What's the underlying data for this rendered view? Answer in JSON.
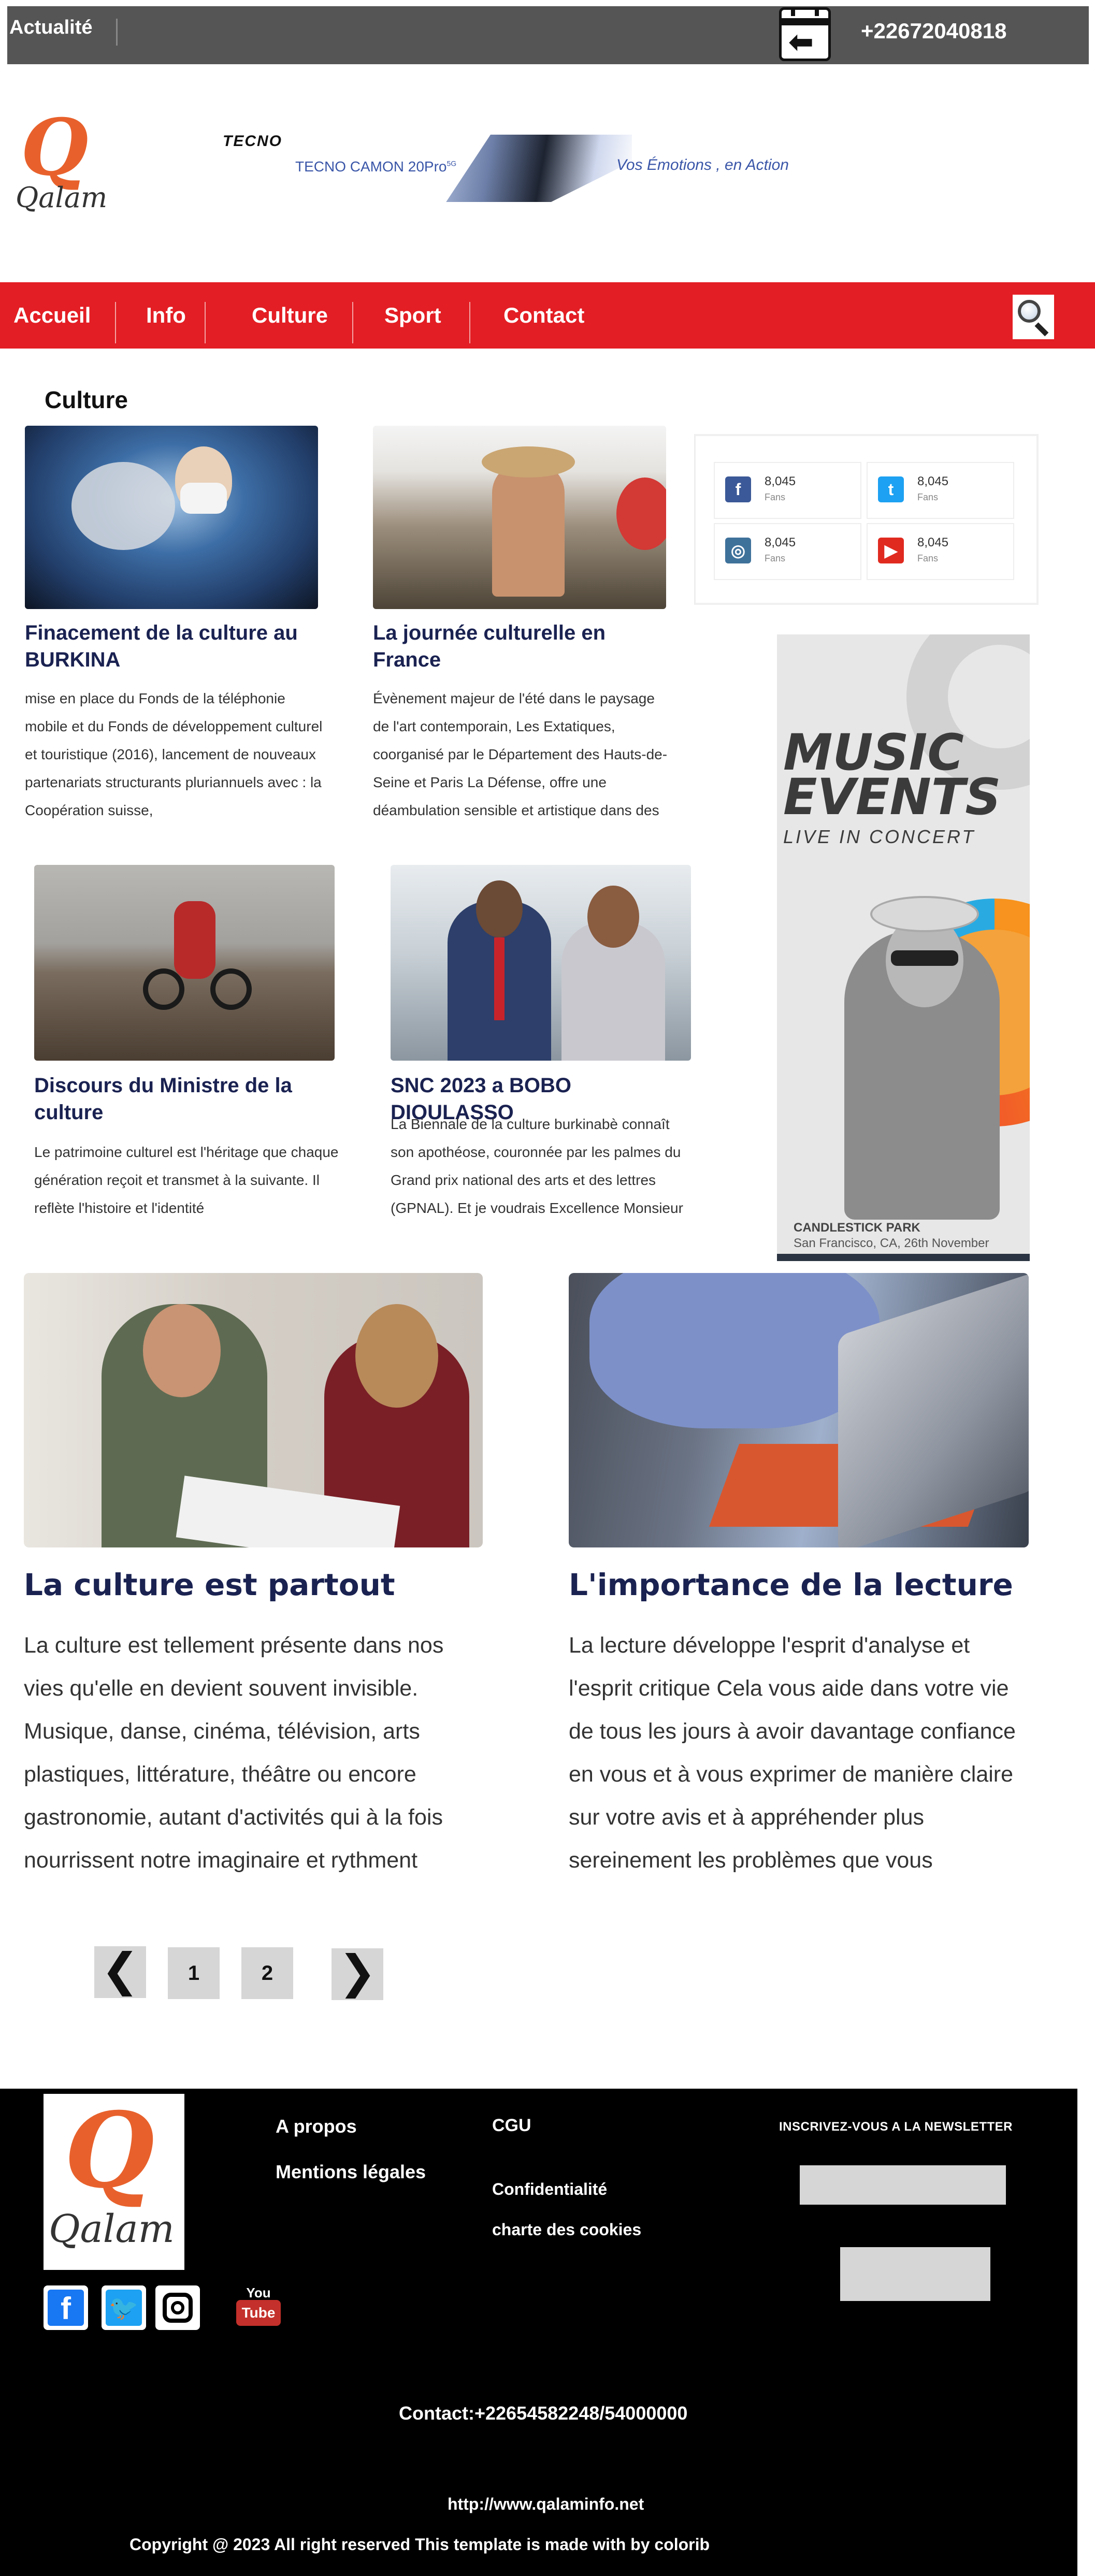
{
  "topbar": {
    "actualite": "Actualité",
    "phone": "+22672040818",
    "calendar_icon": "calendar-back-icon"
  },
  "header": {
    "logo_letter": "Q",
    "logo_text": "Qalam",
    "ad": {
      "brand": "TECNO",
      "model": "TECNO CAMON 20Pro",
      "model_sup": "5G",
      "slogan": "Vos Émotions , en Action"
    }
  },
  "nav": {
    "items": [
      "Accueil",
      "Info",
      "Culture",
      "Sport",
      "Contact"
    ],
    "search_icon": "search-icon"
  },
  "section": {
    "title": "Culture"
  },
  "articles": [
    {
      "title": "Finacement de la culture au BURKINA",
      "excerpt": "mise en place du Fonds de la téléphonie mobile et du Fonds de développement culturel et touristique (2016), lancement de nouveaux partenariats structurants pluriannuels avec : la Coopération suisse,"
    },
    {
      "title": "La journée culturelle en France",
      "excerpt": "Évènement majeur de l'été dans le paysage de l'art contemporain, Les Extatiques, coorganisé par le Département des Hauts-de-Seine et Paris La Défense, offre une déambulation sensible et artistique dans des"
    },
    {
      "title": "Discours du Ministre de la culture",
      "excerpt": "Le patrimoine culturel est l'héritage que chaque génération reçoit et transmet à la suivante. Il reflète l'histoire et l'identité"
    },
    {
      "title": "SNC 2023 a BOBO DIOULASSO",
      "excerpt": "La Biennale de la culture burkinabè connaît son apothéose, couronnée par les palmes du Grand prix national des arts et des lettres (GPNAL). Et je voudrais Excellence Monsieur"
    }
  ],
  "social": [
    {
      "network": "facebook",
      "icon": "f",
      "count": "8,045",
      "label": "Fans",
      "color": "#3b5998"
    },
    {
      "network": "twitter",
      "icon": "t",
      "count": "8,045",
      "label": "Fans",
      "color": "#1da1f2"
    },
    {
      "network": "instagram",
      "icon": "◎",
      "count": "8,045",
      "label": "Fans",
      "color": "#3f729b"
    },
    {
      "network": "youtube",
      "icon": "▶",
      "count": "8,045",
      "label": "Fans",
      "color": "#e02a20"
    }
  ],
  "music_ad": {
    "line1": "MUSIC",
    "line2": "EVENTS",
    "line3": "LIVE IN CONCERT",
    "venue": "CANDLESTICK PARK",
    "place": "San Francisco, CA, 26th November"
  },
  "big_articles": [
    {
      "title": "La culture est partout",
      "lines": [
        "La culture est tellement présente dans nos",
        "vies qu'elle en devient souvent invisible.",
        "Musique, danse, cinéma, télévision, arts",
        "plastiques, littérature, théâtre ou encore",
        "gastronomie, autant d'activités qui à la fois",
        "nourrissent notre imaginaire et rythment"
      ]
    },
    {
      "title": "L'importance de la lecture",
      "lines": [
        "La lecture développe l'esprit d'analyse et",
        "l'esprit critique Cela vous aide dans votre vie",
        "de tous les jours à avoir davantage confiance",
        "en vous et à vous exprimer de manière claire",
        "sur votre avis et à appréhender plus",
        "sereinement les problèmes que vous"
      ]
    }
  ],
  "pagination": {
    "prev": "❮",
    "pages": [
      "1",
      "2"
    ],
    "next": "❯"
  },
  "footer": {
    "logo_letter": "Q",
    "logo_text": "Qalam",
    "links_col1": [
      "A propos",
      "Mentions légales"
    ],
    "links_col2": [
      "CGU",
      "Confidentialité",
      "charte des cookies"
    ],
    "newsletter_title": "INSCRIVEZ-VOUS A LA NEWSLETTER",
    "social_icons": [
      "facebook-icon",
      "twitter-icon",
      "instagram-icon",
      "youtube-icon"
    ],
    "youtube_text": [
      "You",
      "Tube"
    ],
    "contact": "Contact:+22654582248/54000000",
    "url": "http://www.qalaminfo.net",
    "copyright": "Copyright @ 2023 All right reserved  This template is made with by colorib"
  }
}
